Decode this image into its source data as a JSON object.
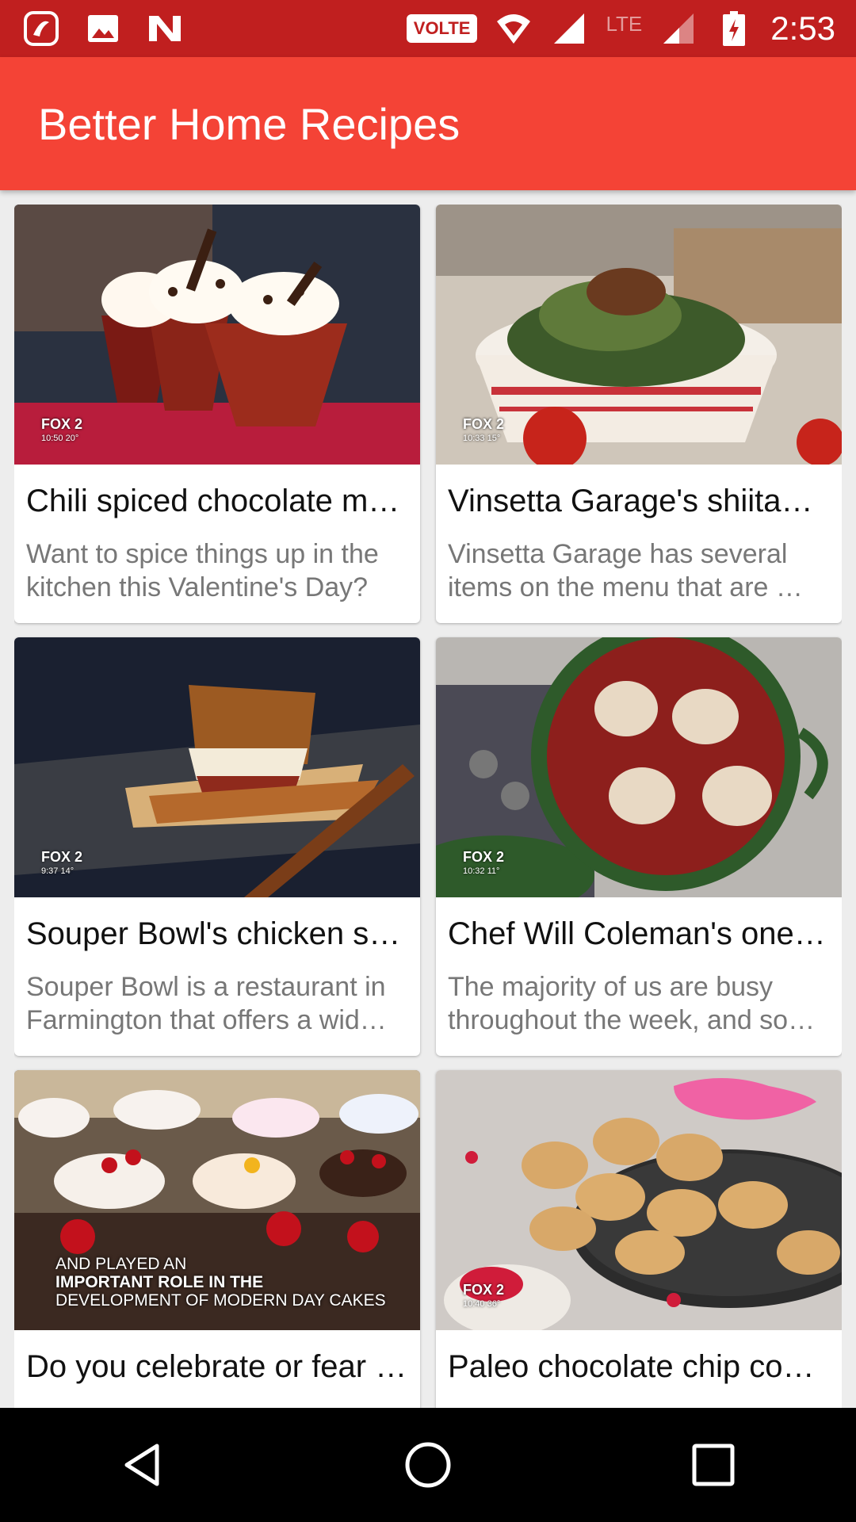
{
  "status_bar": {
    "time": "2:53",
    "volte_label": "VOLTE",
    "network_label": "LTE",
    "left_icons": [
      "saavn-icon",
      "image-icon",
      "n-icon"
    ]
  },
  "app_bar": {
    "title": "Better Home Recipes"
  },
  "cards": [
    {
      "title": "Chili spiced chocolate m…",
      "description": "Want to spice things up in the kitchen this Valentine's Day?",
      "watermark": "FOX 2",
      "watermark_time": "10:50 20°"
    },
    {
      "title": "Vinsetta Garage's shiita…",
      "description": "Vinsetta Garage has several items on the menu that are …",
      "watermark": "FOX 2",
      "watermark_time": "10:33 15°"
    },
    {
      "title": "Souper Bowl's chicken s…",
      "description": "Souper Bowl is a restaurant in Farmington that offers a wid…",
      "watermark": "FOX 2",
      "watermark_time": "9:37 14°"
    },
    {
      "title": "Chef Will Coleman's one …",
      "description": "The majority of us are busy throughout the week, and so…",
      "watermark": "FOX 2",
      "watermark_time": "10:32 11°"
    },
    {
      "title": "Do you celebrate or fear …",
      "caption_lines": [
        "AND PLAYED AN",
        "IMPORTANT ROLE IN THE",
        "DEVELOPMENT OF MODERN DAY CAKES"
      ]
    },
    {
      "title": "Paleo chocolate chip co…",
      "watermark": "FOX 2",
      "watermark_time": "10:40 36°"
    }
  ],
  "colors": {
    "status_bar": "#c01f1f",
    "app_bar": "#f44336",
    "background": "#ededed",
    "title_text": "#111111",
    "desc_text": "#777777"
  },
  "nav_bar": {
    "icons": [
      "back-icon",
      "home-icon",
      "recents-icon"
    ]
  }
}
